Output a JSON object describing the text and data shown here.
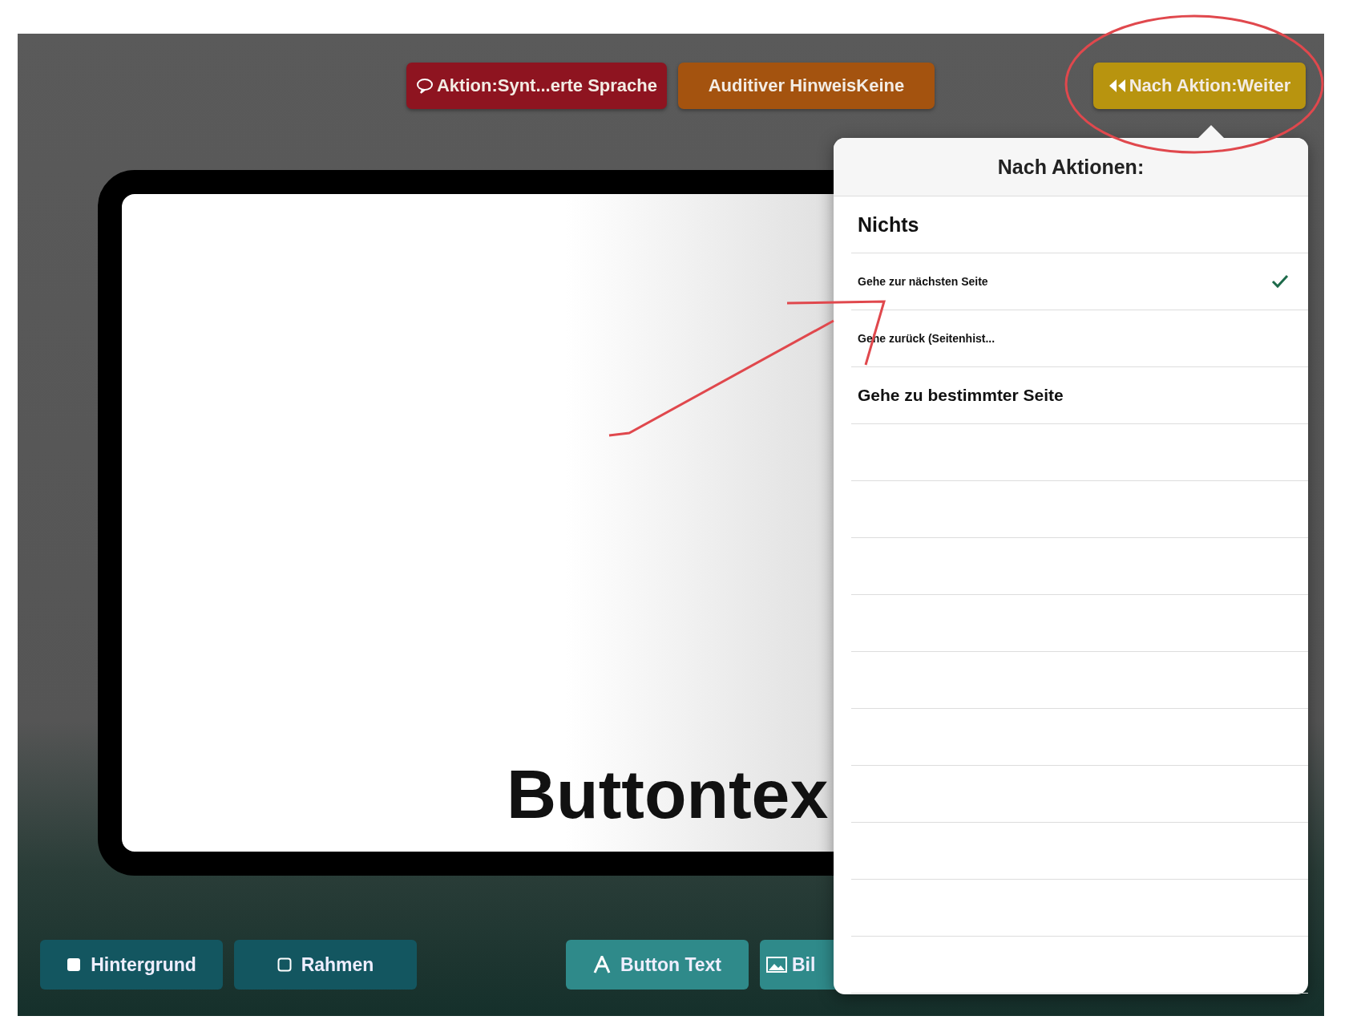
{
  "toolbar": {
    "buttons": [
      {
        "label": "Aktion:Synt...erte Sprache",
        "color": "#8e1420",
        "kind": "speech"
      },
      {
        "label": "Auditiver HinweisKeine",
        "color": "#a4530f",
        "kind": "plain"
      },
      {
        "label": "Nach Aktion:Weiter",
        "color": "#b8940f",
        "kind": "rewind"
      }
    ]
  },
  "canvas": {
    "button_text": "Buttontex"
  },
  "popover": {
    "title": "Nach Aktionen:",
    "options": [
      {
        "label": "Nichts",
        "kind": "large",
        "selected": false
      },
      {
        "label": "Gehe zur nächsten Seite",
        "kind": "small",
        "selected": true
      },
      {
        "label": "Gehe zurück (Seitenhist...",
        "kind": "small",
        "selected": false
      },
      {
        "label": "Gehe zu bestimmter Seite",
        "kind": "medium",
        "selected": false
      }
    ]
  },
  "bottom_bar": {
    "buttons": [
      {
        "label": "Hintergrund",
        "kind": "filled-square"
      },
      {
        "label": "Rahmen",
        "kind": "outline-square"
      },
      {
        "label": "Button Text",
        "kind": "letter"
      },
      {
        "label": "Bil",
        "kind": "image"
      }
    ]
  }
}
